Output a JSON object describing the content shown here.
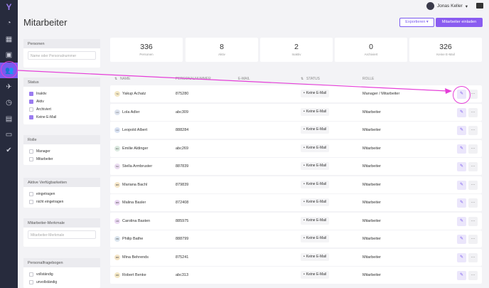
{
  "topbar": {
    "user_name": "Jonas Keller",
    "user_caret": "▾"
  },
  "page": {
    "title": "Mitarbeiter"
  },
  "actions": {
    "export_label": "Exportieren ▾",
    "invite_label": "Mitarbeiter einladen"
  },
  "filters": {
    "persons": {
      "title": "Personen",
      "placeholder": "Name oder Personalnummer"
    },
    "status": {
      "title": "Status",
      "options": [
        {
          "label": "Inaktiv",
          "checked": true
        },
        {
          "label": "Aktiv",
          "checked": true
        },
        {
          "label": "Archiviert",
          "checked": false
        },
        {
          "label": "Keine E-Mail",
          "checked": true
        }
      ]
    },
    "role": {
      "title": "Rolle",
      "options": [
        {
          "label": "Manager",
          "checked": false
        },
        {
          "label": "Mitarbeiter",
          "checked": false
        }
      ]
    },
    "availability": {
      "title": "Aktive Verfügbarkeiten",
      "options": [
        {
          "label": "eingetragen",
          "checked": false
        },
        {
          "label": "nicht eingetragen",
          "checked": false
        }
      ]
    },
    "features": {
      "title": "Mitarbeiter-Merkmale",
      "placeholder": "Mitarbeiter-Merkmale"
    },
    "questionnaire": {
      "title": "Personalfragebogen",
      "options": [
        {
          "label": "vollständig",
          "checked": false
        },
        {
          "label": "unvollständig",
          "checked": false
        }
      ]
    }
  },
  "stats": [
    {
      "value": "336",
      "label": "Personen"
    },
    {
      "value": "8",
      "label": "Aktiv"
    },
    {
      "value": "2",
      "label": "Inaktiv"
    },
    {
      "value": "0",
      "label": "Archiviert"
    },
    {
      "value": "326",
      "label": "Keine E-Mail"
    }
  ],
  "table": {
    "headers": {
      "name": "NAME",
      "number": "PERSONALNUMMER",
      "email": "E-MAIL",
      "status": "STATUS",
      "role": "ROLLE"
    },
    "rows": [
      {
        "initials": "YA",
        "name": "Yakup Achatz",
        "number": "875280",
        "status": "Keine E-Mail",
        "role": "Manager / Mitarbeiter",
        "color": "#f3e7c4"
      },
      {
        "initials": "LA",
        "name": "Lola Adler",
        "number": "abc309",
        "status": "Keine E-Mail",
        "role": "Mitarbeiter",
        "color": "#dde3ee"
      },
      {
        "initials": "LA",
        "name": "Leopold Albert",
        "number": "888284",
        "status": "Keine E-Mail",
        "role": "Mitarbeiter",
        "color": "#d8e1f2"
      },
      {
        "initials": "EA",
        "name": "Emilie Aldinger",
        "number": "abc269",
        "status": "Keine E-Mail",
        "role": "Mitarbeiter",
        "color": "#dbe9e0"
      },
      {
        "initials": "SA",
        "name": "Stella Armbruster",
        "number": "887839",
        "status": "Keine E-Mail",
        "role": "Mitarbeiter",
        "color": "#eadcf0"
      },
      {
        "initials": "MB",
        "name": "Mariana Bachl",
        "number": "879839",
        "status": "Keine E-Mail",
        "role": "Mitarbeiter",
        "color": "#f5e6c8"
      },
      {
        "initials": "MB",
        "name": "Malina Basler",
        "number": "872408",
        "status": "Keine E-Mail",
        "role": "Mitarbeiter",
        "color": "#ead7f2"
      },
      {
        "initials": "CB",
        "name": "Carolina Basten",
        "number": "885975",
        "status": "Keine E-Mail",
        "role": "Mitarbeiter",
        "color": "#ead7f2"
      },
      {
        "initials": "PB",
        "name": "Philip Bathe",
        "number": "888799",
        "status": "Keine E-Mail",
        "role": "Mitarbeiter",
        "color": "#dbe5ee"
      },
      {
        "initials": "MB",
        "name": "Mina Behrends",
        "number": "875241",
        "status": "Keine E-Mail",
        "role": "Mitarbeiter",
        "color": "#f4e4c6"
      },
      {
        "initials": "RB",
        "name": "Robert Benke",
        "number": "abc313",
        "status": "Keine E-Mail",
        "role": "Mitarbeiter",
        "color": "#f3e7c4"
      }
    ]
  },
  "icons": {
    "logo": "logo-icon",
    "dashboard": "gauge-icon",
    "calendar": "calendar-icon",
    "contacts": "contact-card-icon",
    "employees": "people-icon",
    "flights": "plane-icon",
    "time": "clock-icon",
    "documents": "document-icon",
    "payroll": "wallet-icon",
    "invite": "user-check-icon"
  },
  "colors": {
    "accent": "#7a5af0",
    "sidebar": "#272b3d",
    "annotation": "#e53fd8"
  }
}
